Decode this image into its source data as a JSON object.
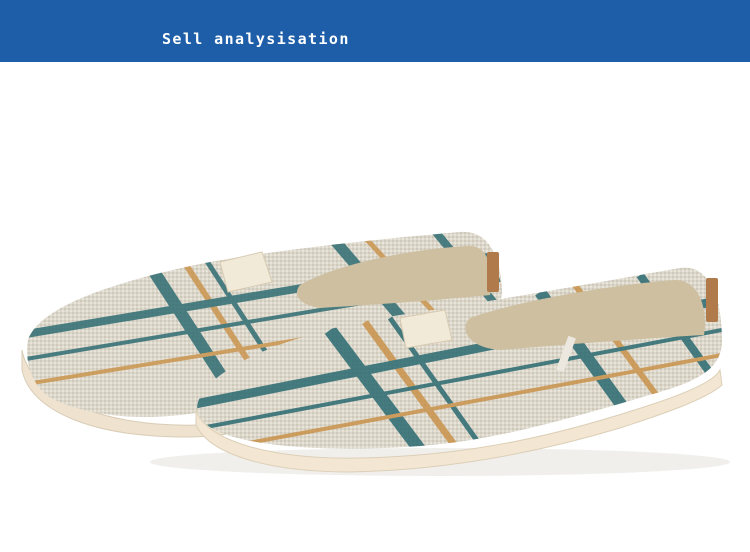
{
  "header": {
    "title": "Sell analysisation"
  },
  "product_image": {
    "subject": "pair of plaid canvas slip-on shoes",
    "colors": {
      "canvas": "#ddd8cc",
      "plaid_teal": "#2f6d73",
      "plaid_orange": "#c9944e",
      "sole": "#f3e7d3",
      "insole": "#cdbf9f"
    }
  },
  "colors": {
    "banner": "#1e5ea9",
    "banner_text": "#ffffff",
    "background": "#ffffff"
  }
}
